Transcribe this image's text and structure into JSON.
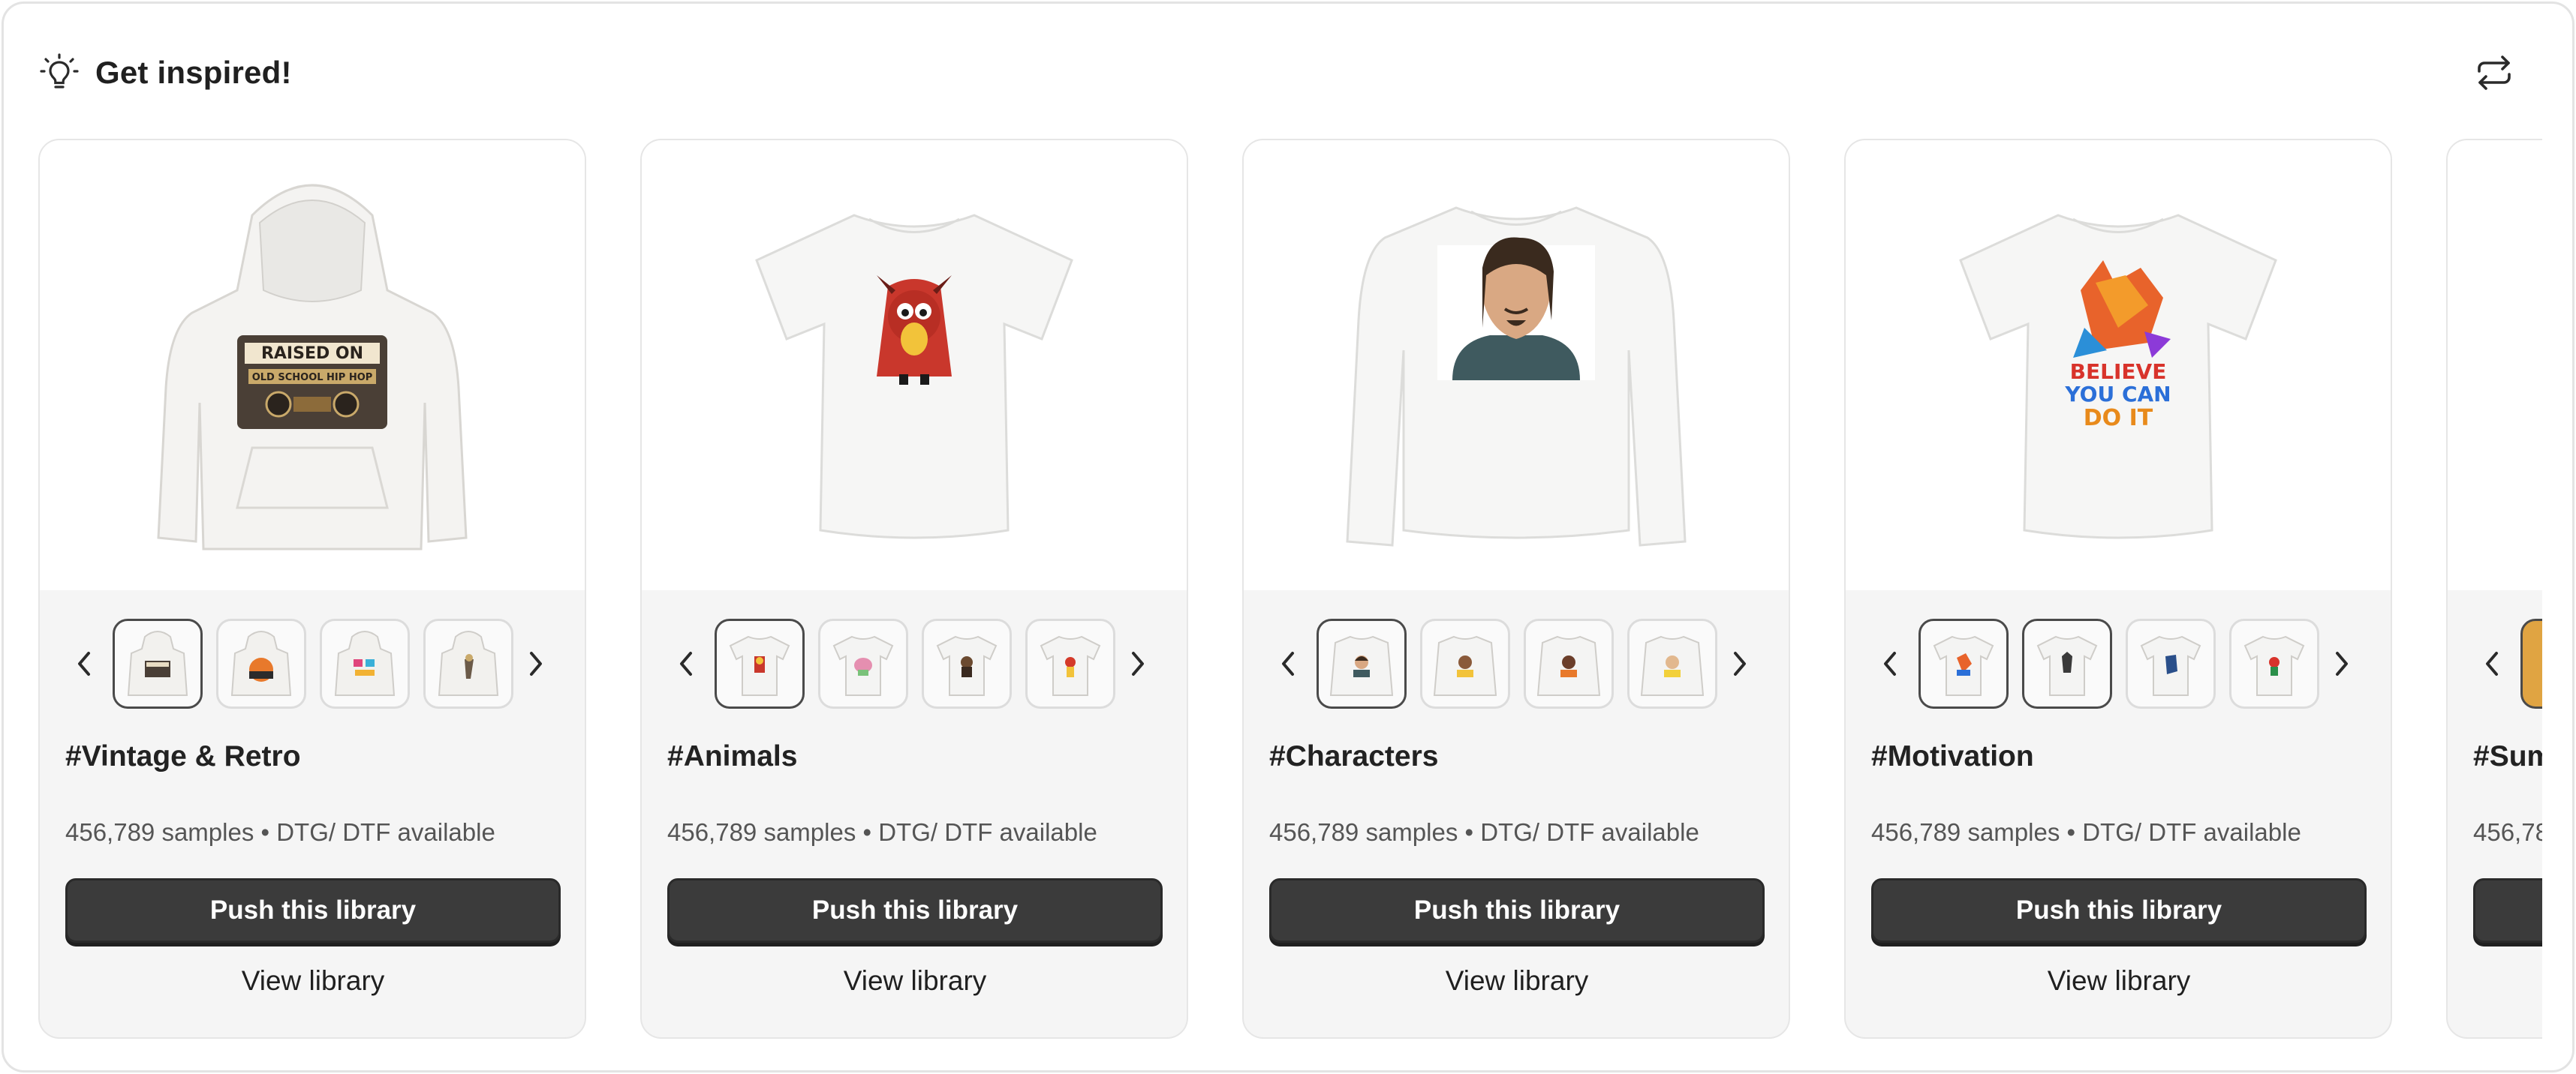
{
  "header": {
    "title": "Get inspired!",
    "icon": "lightbulb-icon",
    "refresh_icon": "refresh-icon"
  },
  "colors": {
    "button_bg": "#3b3b3b",
    "card_bg": "#f5f5f5",
    "border": "#e6e6e6",
    "selected_thumb": "#4a4a4a"
  },
  "cards": [
    {
      "title": "#Vintage & Retro",
      "meta": "456,789 samples • DTG/ DTF available",
      "push_label": "Push this library",
      "view_label": "View library",
      "hero_design_text": [
        "RAISED ON",
        "OLD SCHOOL HIP HOP"
      ]
    },
    {
      "title": "#Animals",
      "meta": "456,789 samples • DTG/ DTF available",
      "push_label": "Push this library",
      "view_label": "View library"
    },
    {
      "title": "#Characters",
      "meta": "456,789 samples • DTG/ DTF available",
      "push_label": "Push this library",
      "view_label": "View library"
    },
    {
      "title": "#Motivation",
      "meta": "456,789 samples • DTG/ DTF available",
      "push_label": "Push this library",
      "view_label": "View library",
      "hero_design_text": [
        "BELIEVE",
        "YOU CAN",
        "DO IT"
      ]
    },
    {
      "title": "#Sum",
      "meta": "456,78",
      "push_label": "",
      "view_label": ""
    }
  ]
}
